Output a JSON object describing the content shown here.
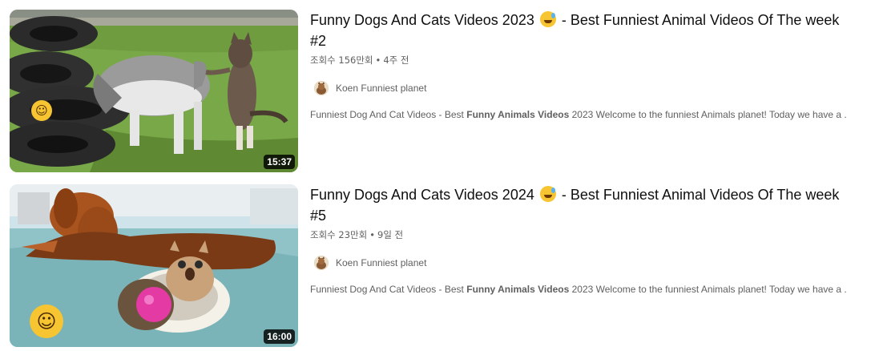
{
  "videos": [
    {
      "title_before_emoji": "Funny Dogs And Cats Videos 2023",
      "title_after_emoji": "- Best Funniest Animal Videos Of The week #2",
      "title_emoji": "grinning-sweat-emoji",
      "views": "조회수 156만회",
      "separator": "•",
      "age": "4주 전",
      "channel": "Koen Funniest planet",
      "desc_prefix": "Funniest Dog And Cat Videos - Best",
      "desc_bold": "Funny Animals Videos",
      "desc_suffix": "2023 Welcome to the funniest Animals planet! Today we have a ...",
      "duration": "15:37",
      "thumb_emoji": "laughing-emoji"
    },
    {
      "title_before_emoji": "Funny Dogs And Cats Videos 2024",
      "title_after_emoji": "- Best Funniest Animal Videos Of The week #5",
      "title_emoji": "grinning-sweat-emoji",
      "views": "조회수 23만회",
      "separator": "•",
      "age": "9일 전",
      "channel": "Koen Funniest planet",
      "desc_prefix": "Funniest Dog And Cat Videos - Best",
      "desc_bold": "Funny Animals Videos",
      "desc_suffix": "2023 Welcome to the funniest Animals planet! Today we have a ...",
      "duration": "16:00",
      "thumb_emoji": "laughing-emoji"
    }
  ],
  "colors": {
    "title": "#0f0f0f",
    "meta": "#606060",
    "duration_bg": "#000000",
    "emoji_yellow": "#f7c531"
  }
}
